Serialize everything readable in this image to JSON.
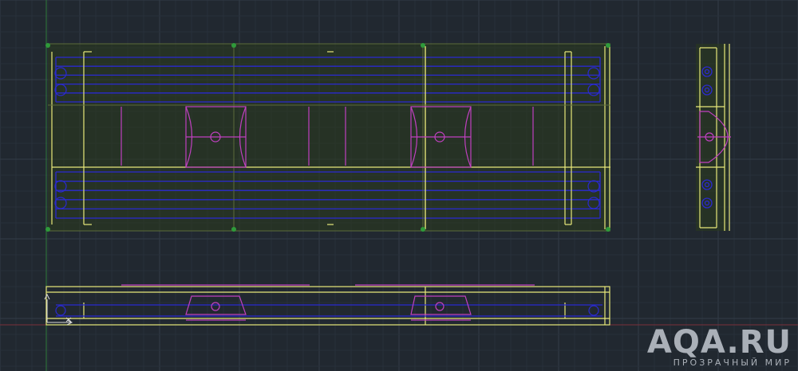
{
  "watermark": {
    "text": "AQA.RU",
    "subtitle": "ПРОЗРАЧНЫЙ МИР"
  },
  "colors": {
    "background": "#212830",
    "grid_minor": "#28303a",
    "grid_major": "#323c47",
    "outline": "#e8e87a",
    "tube": "#2a2ad0",
    "support": "#c040c0",
    "field": "#2c3a1e",
    "axis_x": "#7a2f3a",
    "axis_y": "#2f7a3a"
  },
  "icons": {
    "ucs": "ucs-axis-icon"
  }
}
